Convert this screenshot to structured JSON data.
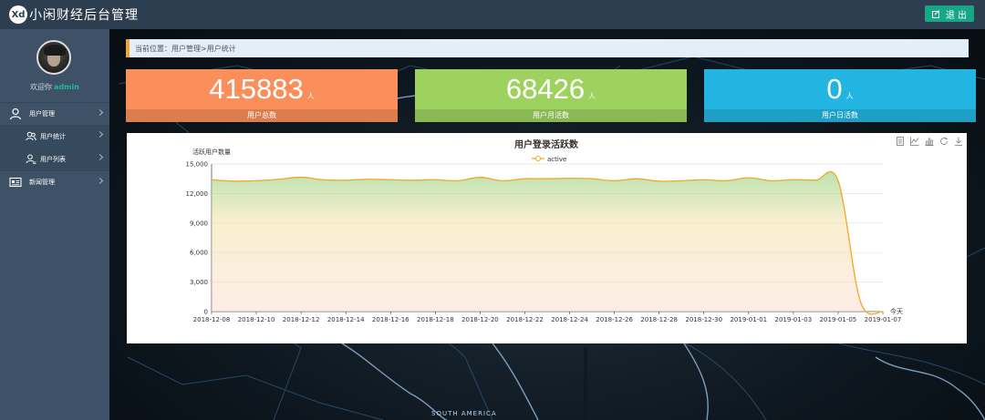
{
  "header": {
    "logo_badge": "Xd",
    "title": "小闲财经后台管理",
    "logout_label": "退 出"
  },
  "sidebar": {
    "welcome": "欢迎你",
    "username": "admin",
    "items": [
      {
        "label": "用户管理",
        "icon": "user-icon"
      },
      {
        "label": "用户统计",
        "icon": "users-icon"
      },
      {
        "label": "用户列表",
        "icon": "user-list-icon"
      },
      {
        "label": "新闻管理",
        "icon": "news-icon"
      }
    ]
  },
  "breadcrumb": "当前位置：用户管理>用户统计",
  "cards": [
    {
      "value": "415883",
      "unit": "人",
      "caption": "用户总数",
      "color": "#fb8f5c"
    },
    {
      "value": "68426",
      "unit": "人",
      "caption": "用户月活数",
      "color": "#9ed25f"
    },
    {
      "value": "0",
      "unit": "人",
      "caption": "用户日活数",
      "color": "#23b5e2"
    }
  ],
  "map_label": "SOUTH AMERICA",
  "chart_data": {
    "type": "area",
    "title": "用户登录活跃数",
    "ylabel": "活跃用户数量",
    "xlabel": "今天",
    "legend": "active",
    "legend_position": "top-center",
    "ylim": [
      0,
      15000
    ],
    "yticks": [
      0,
      3000,
      6000,
      9000,
      12000,
      15000
    ],
    "ytick_labels": [
      "0",
      "3,000",
      "6,000",
      "9,000",
      "12,000",
      "15,000"
    ],
    "grid": true,
    "x_tick_labels": [
      "2018-12-08",
      "2018-12-10",
      "2018-12-12",
      "2018-12-14",
      "2018-12-16",
      "2018-12-18",
      "2018-12-20",
      "2018-12-22",
      "2018-12-24",
      "2018-12-26",
      "2018-12-28",
      "2018-12-30",
      "2019-01-01",
      "2019-01-03",
      "2019-01-05",
      "2019-01-07"
    ],
    "x": [
      "2018-12-08",
      "2018-12-09",
      "2018-12-10",
      "2018-12-11",
      "2018-12-12",
      "2018-12-13",
      "2018-12-14",
      "2018-12-15",
      "2018-12-16",
      "2018-12-17",
      "2018-12-18",
      "2018-12-19",
      "2018-12-20",
      "2018-12-21",
      "2018-12-22",
      "2018-12-23",
      "2018-12-24",
      "2018-12-25",
      "2018-12-26",
      "2018-12-27",
      "2018-12-28",
      "2018-12-29",
      "2018-12-30",
      "2018-12-31",
      "2019-01-01",
      "2019-01-02",
      "2019-01-03",
      "2019-01-04",
      "2019-01-05",
      "2019-01-06",
      "2019-01-07"
    ],
    "series": [
      {
        "name": "active",
        "color": "#f5a623",
        "values": [
          13400,
          13250,
          13300,
          13450,
          13650,
          13400,
          13350,
          13450,
          13400,
          13350,
          13400,
          13300,
          13650,
          13300,
          13500,
          13500,
          13550,
          13500,
          13300,
          13500,
          13250,
          13300,
          13400,
          13300,
          13600,
          13300,
          13400,
          13350,
          13300,
          1000,
          0
        ]
      }
    ]
  },
  "toolbox": [
    "data-view-icon",
    "line-chart-icon",
    "bar-chart-icon",
    "restore-icon",
    "download-icon"
  ]
}
